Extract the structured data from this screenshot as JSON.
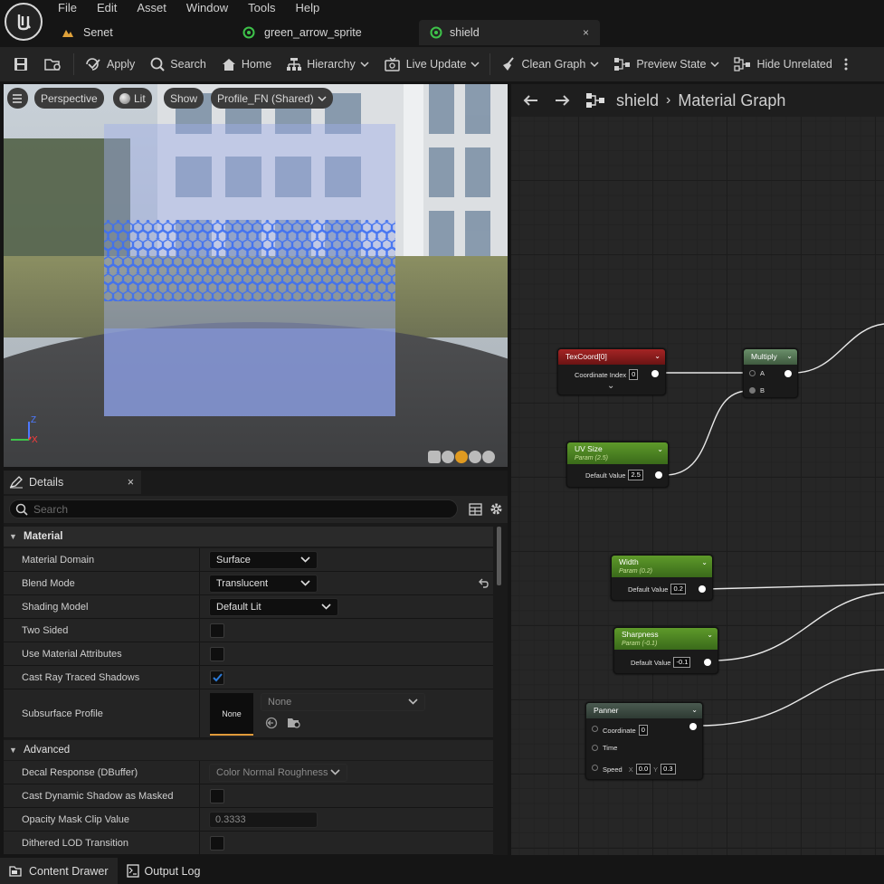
{
  "menu": [
    "File",
    "Edit",
    "Asset",
    "Window",
    "Tools",
    "Help"
  ],
  "tabs": [
    {
      "label": "Senet",
      "icon": "level-icon"
    },
    {
      "label": "green_arrow_sprite",
      "icon": "material-icon"
    },
    {
      "label": "shield",
      "icon": "material-icon",
      "active": true,
      "close": "×"
    }
  ],
  "toolbar": {
    "apply": "Apply",
    "search": "Search",
    "home": "Home",
    "hierarchy": "Hierarchy",
    "live_update": "Live Update",
    "clean_graph": "Clean Graph",
    "preview_state": "Preview State",
    "hide_unrelated": "Hide Unrelated"
  },
  "viewport": {
    "perspective": "Perspective",
    "lit": "Lit",
    "show": "Show",
    "profile": "Profile_FN (Shared)",
    "axis_z": "Z",
    "axis_x": "X"
  },
  "details": {
    "tab_label": "Details",
    "close": "×",
    "search_placeholder": "Search",
    "material_category": "Material",
    "material_domain_label": "Material Domain",
    "material_domain_value": "Surface",
    "blend_mode_label": "Blend Mode",
    "blend_mode_value": "Translucent",
    "shading_model_label": "Shading Model",
    "shading_model_value": "Default Lit",
    "two_sided_label": "Two Sided",
    "two_sided": false,
    "use_material_attributes_label": "Use Material Attributes",
    "use_material_attributes": false,
    "cast_ray_traced_shadows_label": "Cast Ray Traced Shadows",
    "cast_ray_traced_shadows": true,
    "subsurface_profile_label": "Subsurface Profile",
    "subsurface_thumb": "None",
    "subsurface_value": "None",
    "advanced_category": "Advanced",
    "decal_response_label": "Decal Response (DBuffer)",
    "decal_response_value": "Color Normal Roughness",
    "cast_dynamic_shadow_label": "Cast Dynamic Shadow as Masked",
    "cast_dynamic_shadow": false,
    "opacity_mask_label": "Opacity Mask Clip Value",
    "opacity_mask_value": "0.3333",
    "dithered_lod_label": "Dithered LOD Transition",
    "dithered_lod": false
  },
  "graph": {
    "breadcrumb_asset": "shield",
    "breadcrumb_graph": "Material Graph",
    "texcoord": {
      "title": "TexCoord[0]",
      "row_label": "Coordinate Index",
      "row_value": "0"
    },
    "multiply": {
      "title": "Multiply",
      "pin_a": "A",
      "pin_b": "B"
    },
    "uvsize": {
      "title": "UV Size",
      "sub": "Param (2.5)",
      "row_label": "Default Value",
      "row_value": "2.5"
    },
    "width": {
      "title": "Width",
      "sub": "Param (0.2)",
      "row_label": "Default Value",
      "row_value": "0.2"
    },
    "sharpness": {
      "title": "Sharpness",
      "sub": "Param (-0.1)",
      "row_label": "Default Value",
      "row_value": "-0.1"
    },
    "panner": {
      "title": "Panner",
      "coordinate_label": "Coordinate",
      "coordinate_value": "0",
      "time_label": "Time",
      "speed_label": "Speed",
      "speed_x_label": "X",
      "speed_x": "0.0",
      "speed_y_label": "Y",
      "speed_y": "0.3"
    }
  },
  "bottom": {
    "content_drawer": "Content Drawer",
    "output_log": "Output Log"
  },
  "colors": {
    "texcoord_header": "#8a1a1a",
    "param_header": "#4a7a22",
    "math_header": "#4a6a4a",
    "panner_header": "#3a4a40",
    "accent_blue": "#2a7ad8"
  }
}
